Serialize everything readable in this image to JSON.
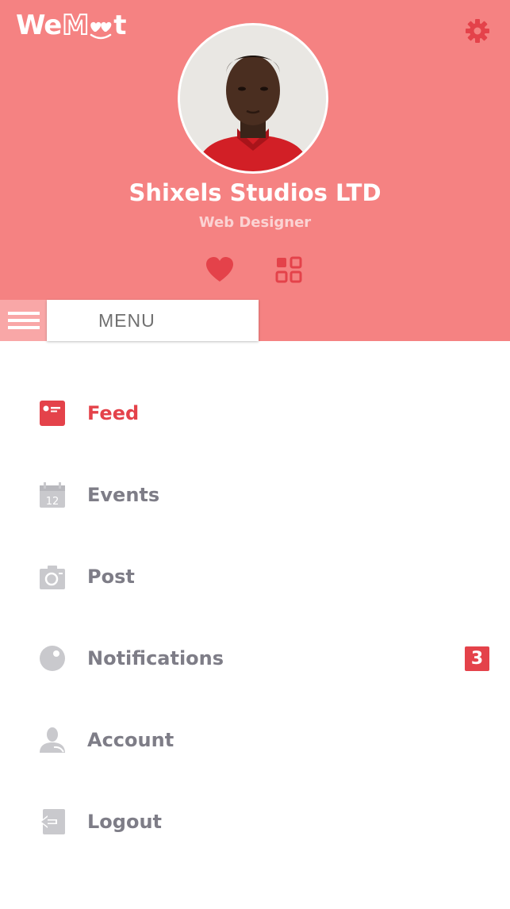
{
  "app": {
    "logo_text_we": "We",
    "logo_text_m": "M",
    "logo_text_t": "t"
  },
  "profile": {
    "name": "Shixels Studios LTD",
    "role": "Web Designer"
  },
  "menu": {
    "label": "MENU"
  },
  "nav": {
    "items": [
      {
        "label": "Feed",
        "icon": "feed-card-icon",
        "active": true
      },
      {
        "label": "Events",
        "icon": "calendar-icon",
        "calendar_day": "12"
      },
      {
        "label": "Post",
        "icon": "camera-icon"
      },
      {
        "label": "Notifications",
        "icon": "notification-bubble-icon",
        "badge": "3"
      },
      {
        "label": "Account",
        "icon": "user-icon"
      },
      {
        "label": "Logout",
        "icon": "logout-icon"
      }
    ]
  },
  "colors": {
    "header_bg": "#f58282",
    "accent": "#e4424a",
    "muted_text": "#7e7d87",
    "icon_gray": "#c9c9cd"
  }
}
